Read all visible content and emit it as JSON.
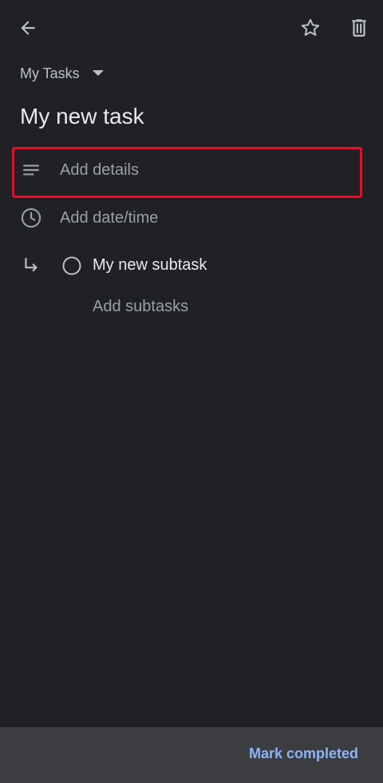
{
  "toolbar": {
    "back_icon": "arrow-back-icon",
    "star_icon": "star-outline-icon",
    "delete_icon": "trash-icon"
  },
  "list_selector": {
    "label": "My Tasks",
    "icon": "dropdown-triangle-icon"
  },
  "task": {
    "title": "My new task"
  },
  "details": {
    "placeholder": "Add details",
    "icon": "notes-lines-icon",
    "highlighted": true,
    "highlight_color": "#ee0a2b"
  },
  "datetime": {
    "placeholder": "Add date/time",
    "icon": "clock-icon"
  },
  "subtasks": {
    "items": [
      {
        "label": "My new subtask",
        "completed": false
      }
    ],
    "add_label": "Add subtasks",
    "icon": "subdirectory-arrow-icon"
  },
  "bottom_bar": {
    "mark_completed_label": "Mark completed",
    "accent_color": "#8ab4f8"
  },
  "colors": {
    "background": "#202124",
    "bottom_bar": "#3c3d41",
    "text_primary": "#e8eaed",
    "text_secondary": "#9aa0a6"
  }
}
